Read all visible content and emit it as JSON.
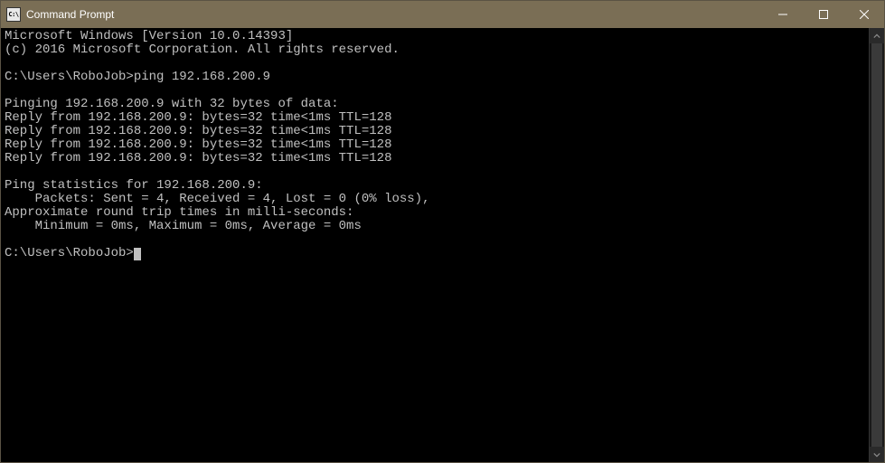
{
  "titlebar": {
    "icon_label": "C:\\",
    "title": "Command Prompt"
  },
  "terminal": {
    "lines": [
      "Microsoft Windows [Version 10.0.14393]",
      "(c) 2016 Microsoft Corporation. All rights reserved.",
      "",
      "C:\\Users\\RoboJob>ping 192.168.200.9",
      "",
      "Pinging 192.168.200.9 with 32 bytes of data:",
      "Reply from 192.168.200.9: bytes=32 time<1ms TTL=128",
      "Reply from 192.168.200.9: bytes=32 time<1ms TTL=128",
      "Reply from 192.168.200.9: bytes=32 time<1ms TTL=128",
      "Reply from 192.168.200.9: bytes=32 time<1ms TTL=128",
      "",
      "Ping statistics for 192.168.200.9:",
      "    Packets: Sent = 4, Received = 4, Lost = 0 (0% loss),",
      "Approximate round trip times in milli-seconds:",
      "    Minimum = 0ms, Maximum = 0ms, Average = 0ms",
      "",
      "C:\\Users\\RoboJob>"
    ]
  }
}
